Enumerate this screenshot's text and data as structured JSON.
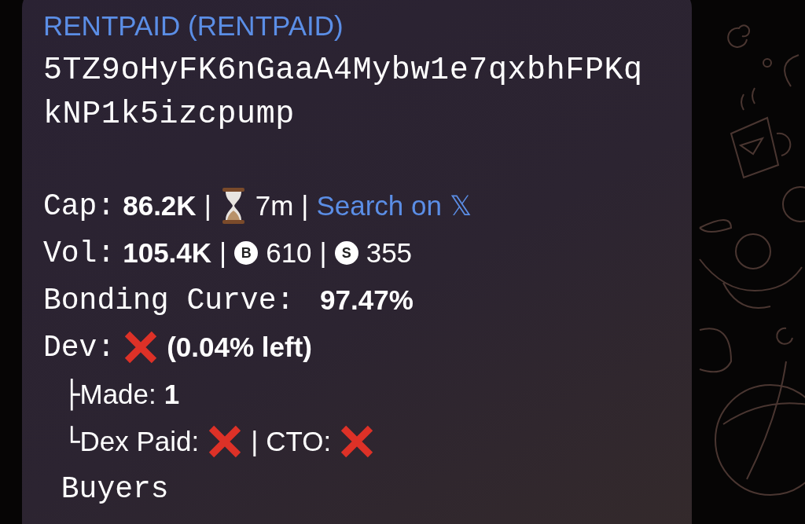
{
  "message": {
    "title": "RENTPAID (RENTPAID)",
    "address_lines": [
      "5TZ9oHyFK6nGaaA4Mybw1e7qxbhFPKq",
      "kNP1k5izcpump"
    ],
    "lines": [
      {
        "parts": [
          {
            "kind": "label",
            "text": "Cap:"
          },
          {
            "kind": "value",
            "text": "86.2K"
          },
          {
            "kind": "separator",
            "text": "|"
          },
          {
            "kind": "hourglass"
          },
          {
            "kind": "text",
            "text": "7m"
          },
          {
            "kind": "separator",
            "text": "|"
          },
          {
            "kind": "link",
            "text": "Search on 𝕏"
          }
        ]
      },
      {
        "parts": [
          {
            "kind": "label",
            "text": "Vol:"
          },
          {
            "kind": "value",
            "text": "105.4K"
          },
          {
            "kind": "separator",
            "text": "|"
          },
          {
            "kind": "badge",
            "text": "B"
          },
          {
            "kind": "text",
            "text": "610"
          },
          {
            "kind": "separator",
            "text": "|"
          },
          {
            "kind": "badge",
            "text": "S"
          },
          {
            "kind": "text",
            "text": "355"
          }
        ]
      },
      {
        "parts": [
          {
            "kind": "label",
            "text": "Bonding Curve: "
          },
          {
            "kind": "value",
            "text": "97.47%"
          }
        ]
      },
      {
        "parts": [
          {
            "kind": "label",
            "text": "Dev:"
          },
          {
            "kind": "status",
            "ok": false
          },
          {
            "kind": "value",
            "text": "(0.04% left)"
          }
        ],
        "children": [
          {
            "parts": [
              {
                "kind": "tree",
                "text": "├"
              },
              {
                "kind": "text",
                "text": "Made:"
              },
              {
                "kind": "value",
                "text": "1"
              }
            ]
          },
          {
            "parts": [
              {
                "kind": "tree",
                "text": "└"
              },
              {
                "kind": "text",
                "text": "Dex Paid:"
              },
              {
                "kind": "status",
                "ok": false
              },
              {
                "kind": "separator",
                "text": "|"
              },
              {
                "kind": "text",
                "text": "CTO:"
              },
              {
                "kind": "status",
                "ok": false
              }
            ]
          }
        ]
      },
      {
        "parts": [
          {
            "kind": "label",
            "text": " Buyers"
          }
        ]
      }
    ]
  }
}
